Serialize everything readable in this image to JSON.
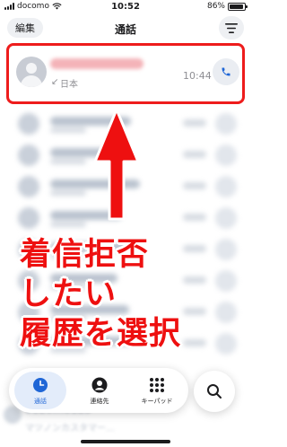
{
  "status_bar": {
    "carrier": "docomo",
    "time": "10:52",
    "battery": "86%"
  },
  "nav": {
    "edit_label": "編集",
    "title": "通話",
    "menu_icon": "hamburger-icon"
  },
  "first_call": {
    "location": "日本",
    "time": "10:44",
    "direction_icon": "incoming-arrow-icon"
  },
  "annotation": {
    "line1": "着信拒否",
    "line2": "したい",
    "line3": "履歴を選択",
    "color": "#ee1010"
  },
  "bottom_blurred": {
    "name": "0120...8123",
    "sub": "マツノンカスタマー..."
  },
  "tabs": [
    {
      "label": "通話",
      "icon": "clock-icon",
      "active": true
    },
    {
      "label": "連絡先",
      "icon": "person-icon",
      "active": false
    },
    {
      "label": "キーパッド",
      "icon": "keypad-icon",
      "active": false
    }
  ],
  "search_icon": "search-icon",
  "colors": {
    "highlight_border": "#ee1c1c",
    "accent": "#1f66d6"
  }
}
